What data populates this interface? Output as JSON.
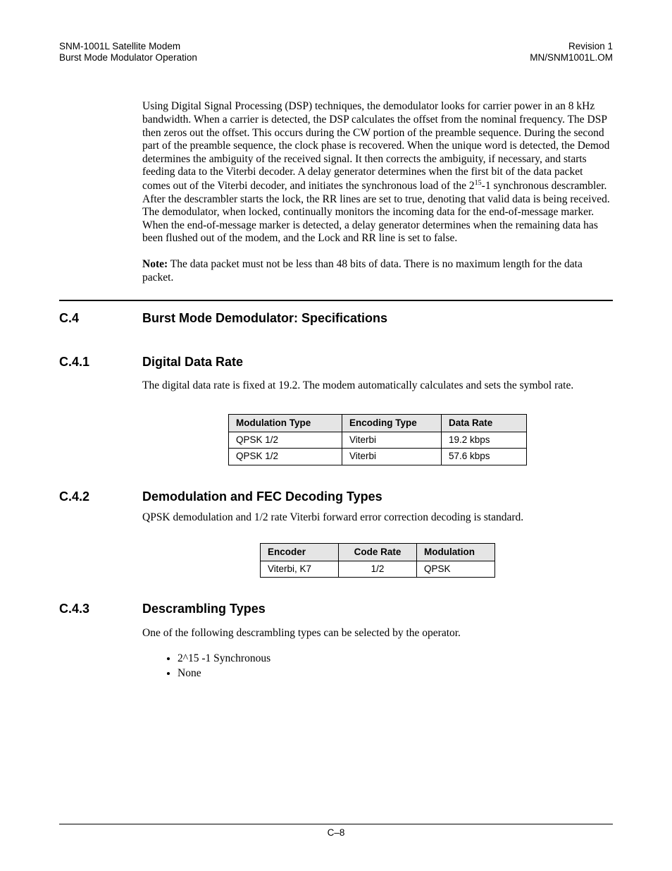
{
  "header": {
    "left_line1": "SNM-1001L Satellite Modem",
    "left_line2": "Burst Mode Modulator Operation",
    "right_line1": "Revision 1",
    "right_line2": "MN/SNM1001L.OM"
  },
  "para1_a": "Using Digital Signal Processing (DSP) techniques, the demodulator looks for carrier power in an 8 kHz bandwidth. When a carrier is detected, the DSP calculates the offset from the nominal frequency. The DSP then zeros out the offset. This occurs during the CW portion of the preamble sequence. During the second part of the preamble sequence, the clock phase is recovered. When the unique word is detected, the Demod determines the ambiguity of the received signal. It then corrects the ambiguity, if necessary, and starts feeding data to the Viterbi decoder. A delay generator determines when the first bit of the data packet comes out of the Viterbi decoder, and initiates the synchronous load of the 2",
  "para1_sup": "15",
  "para1_b": "-1 synchronous descrambler. After the descrambler starts the lock, the RR lines are set to true, denoting that valid data is being received. The demodulator, when locked, continually monitors the incoming data for the end-of-message marker. When the end-of-message marker is detected, a delay generator determines when the remaining data has been flushed out of the modem, and the Lock and RR line is set to false.",
  "note_label": "Note:",
  "note_text": " The data packet must not be less than 48 bits of data. There is no maximum length for the data packet.",
  "sec_c4_num": "C.4",
  "sec_c4_title": "Burst Mode Demodulator: Specifications",
  "sec_c41_num": "C.4.1",
  "sec_c41_title": "Digital Data Rate",
  "sec_c41_para": "The digital data rate is fixed at 19.2. The modem automatically calculates and sets the symbol rate.",
  "table1": {
    "h1": "Modulation Type",
    "h2": "Encoding Type",
    "h3": "Data Rate",
    "r1c1": "QPSK 1/2",
    "r1c2": "Viterbi",
    "r1c3": "19.2 kbps",
    "r2c1": "QPSK 1/2",
    "r2c2": "Viterbi",
    "r2c3": "57.6 kbps"
  },
  "sec_c42_num": "C.4.2",
  "sec_c42_title": "Demodulation and FEC Decoding Types",
  "sec_c42_para": "QPSK demodulation and 1/2 rate Viterbi forward error correction decoding is standard.",
  "table2": {
    "h1": "Encoder",
    "h2": "Code Rate",
    "h3": "Modulation",
    "r1c1": "Viterbi, K7",
    "r1c2": "1/2",
    "r1c3": "QPSK"
  },
  "sec_c43_num": "C.4.3",
  "sec_c43_title": "Descrambling Types",
  "sec_c43_para": "One of the following descrambling types can be selected by the operator.",
  "bullets": {
    "b1": "2^15 -1 Synchronous",
    "b2": "None"
  },
  "footer": "C–8"
}
